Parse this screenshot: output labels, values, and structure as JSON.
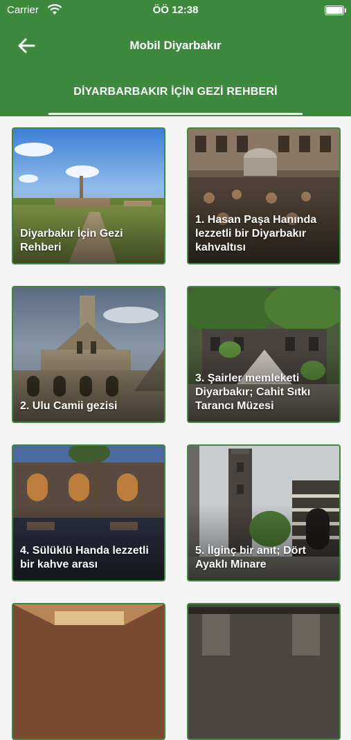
{
  "status_bar": {
    "carrier": "Carrier",
    "time": "ÖÖ 12:38"
  },
  "header": {
    "title": "Mobil Diyarbakır",
    "back_icon": "arrow-left-icon",
    "background_color": "#3d8a3e"
  },
  "tab": {
    "label": "DİYARBARBAKIR İÇİN GEZİ REHBERİ"
  },
  "cards": [
    {
      "caption": "Diyarbakır İçin Gezi Rehberi"
    },
    {
      "caption": "1. Hasan Paşa Hanında lezzetli bir Diyarbakır kahvaltısı"
    },
    {
      "caption": "2. Ulu Camii gezisi"
    },
    {
      "caption": "3. Şairler memleketi Diyarbakır; Cahit Sıtkı Tarancı Müzesi"
    },
    {
      "caption": "4. Sülüklü Handa lezzetli bir kahve arası"
    },
    {
      "caption": "5. İlginç bir anıt; Dört Ayaklı Minare"
    },
    {
      "caption": ""
    },
    {
      "caption": ""
    }
  ]
}
